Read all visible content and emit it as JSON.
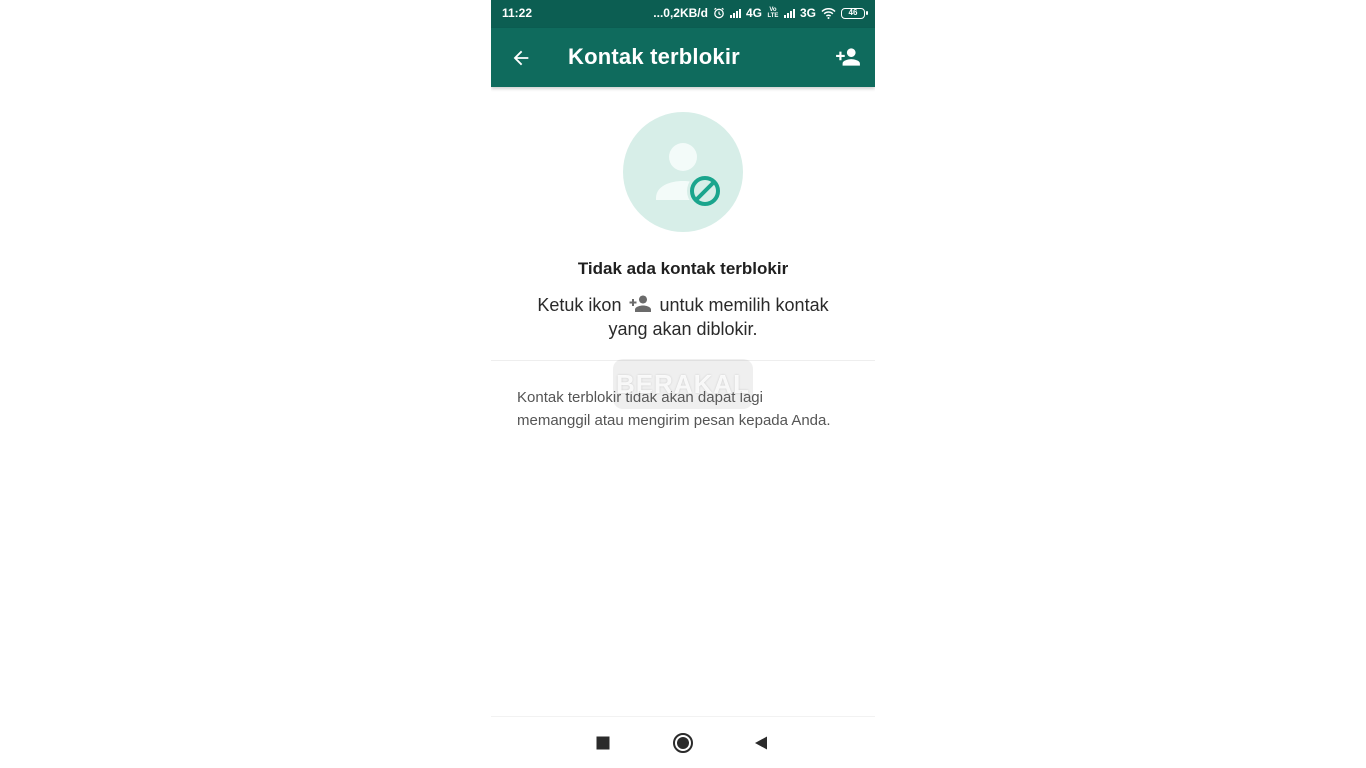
{
  "status_bar": {
    "time": "11:22",
    "speed": "...0,2KB/d",
    "net1": "4G",
    "volte": "Vo LTE",
    "net2": "3G",
    "battery": "46"
  },
  "app_bar": {
    "title": "Kontak terblokir",
    "back_icon": "arrow-left-icon",
    "action_icon": "person-add-icon"
  },
  "empty_state": {
    "illustration_icon": "blocked-contact-icon",
    "title": "Tidak ada kontak terblokir",
    "hint_before": "Ketuk ikon",
    "hint_icon": "person-add-icon",
    "hint_after": "untuk memilih kontak",
    "hint_line2": "yang akan diblokir."
  },
  "watermark": "BERAKAL",
  "info": {
    "line1": "Kontak terblokir tidak akan dapat lagi",
    "line2": "memanggil atau mengirim pesan kepada Anda."
  },
  "nav_bar": {
    "recents_icon": "square-icon",
    "home_icon": "circle-icon",
    "back_icon": "triangle-back-icon"
  },
  "colors": {
    "status_bar": "#0c5e52",
    "app_bar": "#0f6b5d",
    "accent": "#1aa58d",
    "illustration_bg": "#d7eee8"
  }
}
